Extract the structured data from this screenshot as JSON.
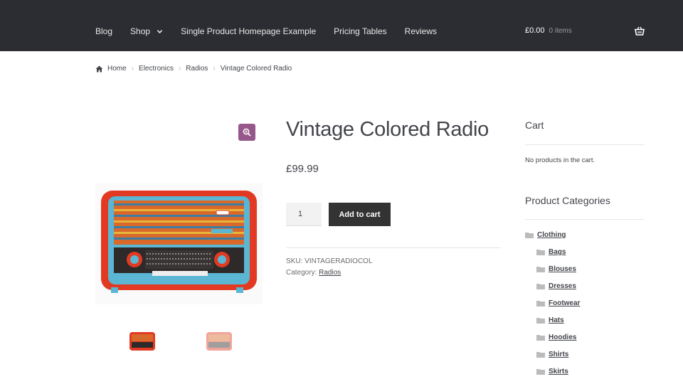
{
  "nav": {
    "items": [
      "Blog",
      "Shop",
      "Single Product Homepage Example",
      "Pricing Tables",
      "Reviews"
    ]
  },
  "cart_summary": {
    "amount": "£0.00",
    "count": "0 items"
  },
  "breadcrumb": [
    "Home",
    "Electronics",
    "Radios",
    "Vintage Colored Radio"
  ],
  "product": {
    "title": "Vintage Colored Radio",
    "price": "£99.99",
    "quantity": "1",
    "add_to_cart": "Add to cart",
    "sku_label": "SKU:",
    "sku": "VINTAGERADIOCOL",
    "category_label": "Category:",
    "category": "Radios"
  },
  "sidebar": {
    "cart_title": "Cart",
    "cart_empty": "No products in the cart.",
    "categories_title": "Product Categories",
    "categories": [
      "Clothing",
      "Bags",
      "Blouses",
      "Dresses",
      "Footwear",
      "Hats",
      "Hoodies",
      "Shirts",
      "Skirts"
    ]
  },
  "colors": {
    "header_bg": "#2c2d33",
    "accent": "#96588a",
    "button": "#333333"
  },
  "icons": {
    "home": "home-icon",
    "chevron": "chevron-down-icon",
    "basket": "basket-icon",
    "zoom": "zoom-icon",
    "folder": "folder-icon"
  }
}
